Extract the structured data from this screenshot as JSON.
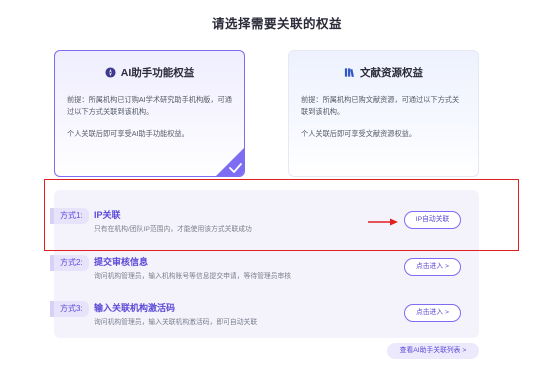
{
  "page": {
    "title": "请选择需要关联的权益"
  },
  "cards": {
    "ai": {
      "title": "AI助手功能权益",
      "premise": "前提：所属机构已订购AI学术研究助手机构版，可通过以下方式关联到该机构。",
      "note": "个人关联后即可享受AI助手功能权益。"
    },
    "doc": {
      "title": "文献资源权益",
      "premise": "前提：所属机构已购文献资源，可通过以下方式关联到该机构。",
      "note": "个人关联后即可享受文献资源权益。"
    }
  },
  "methods": [
    {
      "tag": "方式1:",
      "title": "IP关联",
      "desc": "只有在机构/团队IP范围内，才能使用该方式关联成功",
      "button": "IP自动关联"
    },
    {
      "tag": "方式2:",
      "title": "提交审核信息",
      "desc": "询问机构管理员，输入机构账号等信息提交申请，等待管理员审核",
      "button": "点击进入 >"
    },
    {
      "tag": "方式3:",
      "title": "输入关联机构激活码",
      "desc": "询问机构管理员，输入关联机构激活码，即可自动关联",
      "button": "点击进入 >"
    }
  ],
  "footer": {
    "list_link": "查看AI助手关联列表 >"
  },
  "colors": {
    "accent": "#5b49d6",
    "highlight": "#e02020"
  }
}
